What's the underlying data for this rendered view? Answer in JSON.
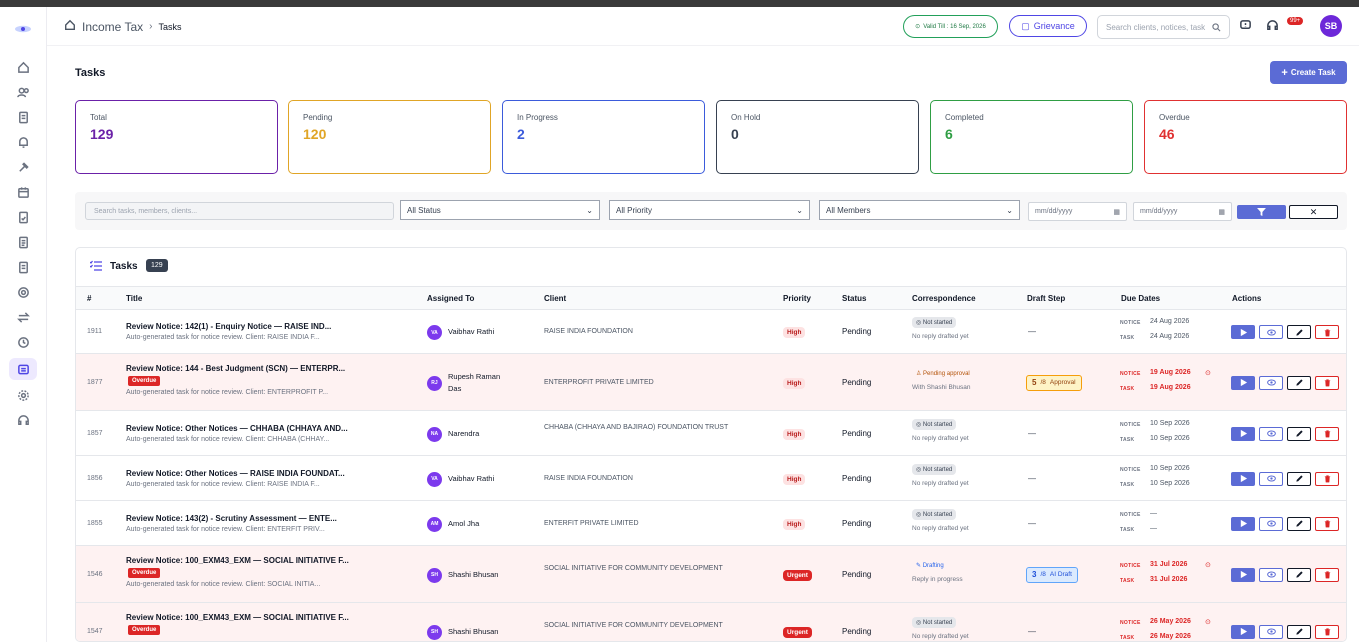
{
  "header": {
    "breadcrumb": [
      "Income Tax",
      "Tasks"
    ],
    "valid_till": "Valid Till : 16 Sep, 2026",
    "grievance": "Grievance",
    "search_placeholder": "Search clients, notices, task",
    "notif_badge": "99+",
    "avatar": "SB"
  },
  "page": {
    "title": "Tasks",
    "create_label": "Create Task"
  },
  "stats": [
    {
      "label": "Total",
      "value": "129",
      "color": "#6b21a8"
    },
    {
      "label": "Pending",
      "value": "120",
      "color": "#e0a526"
    },
    {
      "label": "In Progress",
      "value": "2",
      "color": "#3b5bdb"
    },
    {
      "label": "On Hold",
      "value": "0",
      "color": "#374151"
    },
    {
      "label": "Completed",
      "value": "6",
      "color": "#2f9e44"
    },
    {
      "label": "Overdue",
      "value": "46",
      "color": "#e03131"
    }
  ],
  "filters": {
    "search_placeholder": "Search tasks, members, clients...",
    "status": "All Status",
    "priority": "All Priority",
    "members": "All Members",
    "date_from": "mm/dd/yyyy",
    "date_to": "mm/dd/yyyy"
  },
  "table": {
    "title": "Tasks",
    "count": "129",
    "headers": [
      "#",
      "Title",
      "Assigned To",
      "Client",
      "Priority",
      "Status",
      "Correspondence",
      "Draft Step",
      "Due Dates",
      "Actions"
    ],
    "notice_label": "NOTICE",
    "task_label": "TASK",
    "overdue_label": "Overdue",
    "rows": [
      {
        "id": "1911",
        "title": "Review Notice: 142(1) - Enquiry Notice — RAISE IND...",
        "sub": "Auto-generated task for notice review. Client: RAISE INDIA F...",
        "overdue": false,
        "initials": "VA",
        "assignee": "Vaibhav Rathi",
        "client": "RAISE INDIA FOUNDATION",
        "priority": "High",
        "status": "Pending",
        "corr": "Not started",
        "corr_sub": "No reply drafted yet",
        "draft": "—",
        "notice_date": "24 Aug 2026",
        "task_date": "24 Aug 2026"
      },
      {
        "id": "1877",
        "title": "Review Notice: 144 - Best Judgment (SCN) — ENTERPR...",
        "sub": "Auto-generated task for notice review. Client: ENTERPROFIT P...",
        "overdue": true,
        "initials": "RJ",
        "assignee": "Rupesh Raman Das",
        "client": "ENTERPROFIT PRIVATE LIMITED",
        "priority": "High",
        "status": "Pending",
        "corr": "Pending approval",
        "corr_sub": "With Shashi Bhusan",
        "draft_num": "5",
        "draft_label": "Approval",
        "notice_date": "19 Aug 2026",
        "task_date": "19 Aug 2026"
      },
      {
        "id": "1857",
        "title": "Review Notice: Other Notices — CHHABA (CHHAYA AND...",
        "sub": "Auto-generated task for notice review. Client: CHHABA (CHHAY...",
        "overdue": false,
        "initials": "NA",
        "assignee": "Narendra",
        "client": "CHHABA (CHHAYA AND BAJIRAO) FOUNDATION TRUST",
        "priority": "High",
        "status": "Pending",
        "corr": "Not started",
        "corr_sub": "No reply drafted yet",
        "draft": "—",
        "notice_date": "10 Sep 2026",
        "task_date": "10 Sep 2026"
      },
      {
        "id": "1856",
        "title": "Review Notice: Other Notices — RAISE INDIA FOUNDAT...",
        "sub": "Auto-generated task for notice review. Client: RAISE INDIA F...",
        "overdue": false,
        "initials": "VA",
        "assignee": "Vaibhav Rathi",
        "client": "RAISE INDIA FOUNDATION",
        "priority": "High",
        "status": "Pending",
        "corr": "Not started",
        "corr_sub": "No reply drafted yet",
        "draft": "—",
        "notice_date": "10 Sep 2026",
        "task_date": "10 Sep 2026"
      },
      {
        "id": "1855",
        "title": "Review Notice: 143(2) - Scrutiny Assessment — ENTE...",
        "sub": "Auto-generated task for notice review. Client: ENTERFIT PRIV...",
        "overdue": false,
        "initials": "AM",
        "assignee": "Amol Jha",
        "client": "ENTERFIT PRIVATE LIMITED",
        "priority": "High",
        "status": "Pending",
        "corr": "Not started",
        "corr_sub": "No reply drafted yet",
        "draft": "—",
        "notice_date": "—",
        "task_date": "—"
      },
      {
        "id": "1546",
        "title": "Review Notice: 100_EXM43_EXM — SOCIAL INITIATIVE F...",
        "sub": "Auto-generated task for notice review. Client: SOCIAL INITIA...",
        "overdue": true,
        "initials": "SH",
        "assignee": "Shashi Bhusan",
        "client": "SOCIAL INITIATIVE FOR COMMUNITY DEVELOPMENT",
        "priority": "Urgent",
        "status": "Pending",
        "corr": "Drafting",
        "corr_sub": "Reply in progress",
        "draft_num": "3",
        "draft_label": "AI Draft",
        "notice_date": "31 Jul 2026",
        "task_date": "31 Jul 2026"
      },
      {
        "id": "1547",
        "title": "Review Notice: 100_EXM43_EXM — SOCIAL INITIATIVE F...",
        "sub": "",
        "overdue": true,
        "initials": "SH",
        "assignee": "Shashi Bhusan",
        "client": "SOCIAL INITIATIVE FOR COMMUNITY DEVELOPMENT",
        "priority": "Urgent",
        "status": "Pending",
        "corr": "Not started",
        "corr_sub": "No reply drafted yet",
        "draft": "—",
        "notice_date": "26 May 2026",
        "task_date": "26 May 2026"
      }
    ]
  }
}
